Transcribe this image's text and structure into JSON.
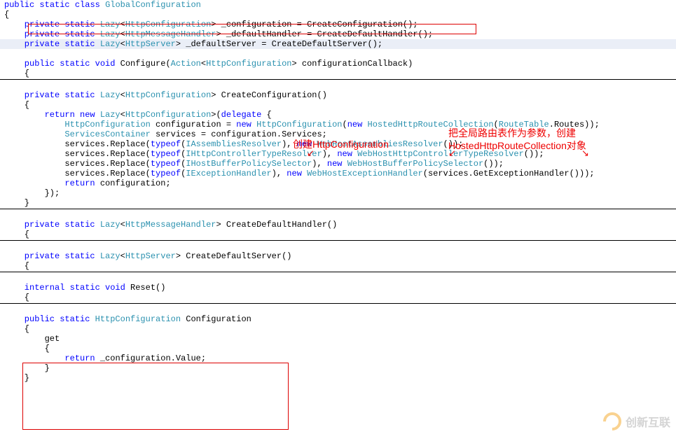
{
  "code": {
    "l1": "public static class GlobalConfiguration",
    "l2": "{",
    "l3a": "    private static ",
    "l3b": "Lazy",
    "l3c": "<",
    "l3d": "HttpConfiguration",
    "l3e": "> _configuration = CreateConfiguration();",
    "l4a": "    private static ",
    "l4b": "Lazy",
    "l4c": "<",
    "l4d": "HttpMessageHandler",
    "l4e": "> _defaultHandler = CreateDefaultHandler();",
    "l5a": "    private static ",
    "l5b": "Lazy",
    "l5c": "<",
    "l5d": "HttpServer",
    "l5e": "> _defaultServer = CreateDefaultServer();",
    "l6": " ",
    "l7a": "    public static void ",
    "l7b": "Configure(",
    "l7c": "Action",
    "l7d": "<",
    "l7e": "HttpConfiguration",
    "l7f": "> configurationCallback)",
    "l8": "    {",
    "l9": " ",
    "l10a": "    private static ",
    "l10b": "Lazy",
    "l10c": "<",
    "l10d": "HttpConfiguration",
    "l10e": "> CreateConfiguration()",
    "l11": "    {",
    "l12a": "        return new ",
    "l12b": "Lazy",
    "l12c": "<",
    "l12d": "HttpConfiguration",
    "l12e": ">(",
    "l12f": "delegate ",
    "l12g": "{",
    "l13a": "            ",
    "l13b": "HttpConfiguration",
    "l13c": " configuration = ",
    "l13d": "new ",
    "l13e": "HttpConfiguration",
    "l13f": "(",
    "l13g": "new ",
    "l13h": "HostedHttpRouteCollection",
    "l13i": "(",
    "l13j": "RouteTable",
    "l13k": ".Routes));",
    "l14a": "            ",
    "l14b": "ServicesContainer",
    "l14c": " services = configuration.Services;",
    "l15a": "            services.Replace(",
    "l15b": "typeof",
    "l15c": "(",
    "l15d": "IAssembliesResolver",
    "l15e": "), ",
    "l15f": "new ",
    "l15g": "WebHostAssembliesResolver",
    "l15h": "());",
    "l16a": "            services.Replace(",
    "l16b": "typeof",
    "l16c": "(",
    "l16d": "IHttpControllerTypeResolver",
    "l16e": "), ",
    "l16f": "new ",
    "l16g": "WebHostHttpControllerTypeResolver",
    "l16h": "());",
    "l17a": "            services.Replace(",
    "l17b": "typeof",
    "l17c": "(",
    "l17d": "IHostBufferPolicySelector",
    "l17e": "), ",
    "l17f": "new ",
    "l17g": "WebHostBufferPolicySelector",
    "l17h": "());",
    "l18a": "            services.Replace(",
    "l18b": "typeof",
    "l18c": "(",
    "l18d": "IExceptionHandler",
    "l18e": "), ",
    "l18f": "new ",
    "l18g": "WebHostExceptionHandler",
    "l18h": "(services.GetExceptionHandler()));",
    "l19a": "            ",
    "l19b": "return ",
    "l19c": "configuration;",
    "l20": "        });",
    "l21": "    }",
    "l22": " ",
    "l23a": "    private static ",
    "l23b": "Lazy",
    "l23c": "<",
    "l23d": "HttpMessageHandler",
    "l23e": "> CreateDefaultHandler()",
    "l24": "    {",
    "l25": " ",
    "l26a": "    private static ",
    "l26b": "Lazy",
    "l26c": "<",
    "l26d": "HttpServer",
    "l26e": "> CreateDefaultServer()",
    "l27": "    {",
    "l28": " ",
    "l29a": "    internal static void ",
    "l29b": "Reset()",
    "l30": "    {",
    "l31": " ",
    "l32a": "    public static ",
    "l32b": "HttpConfiguration",
    "l32c": " Configuration",
    "l33": "    {",
    "l34": "        get",
    "l35": "        {",
    "l36a": "            ",
    "l36b": "return ",
    "l36c": "_configuration.Value;",
    "l37": "        }",
    "l38": "    }"
  },
  "annot": {
    "a1": "创建HttpConfiguration",
    "a2_line1": "把全局路由表作为参数，创建",
    "a2_line2": "HostedHttpRouteCollection对象"
  },
  "watermark": "创新互联"
}
